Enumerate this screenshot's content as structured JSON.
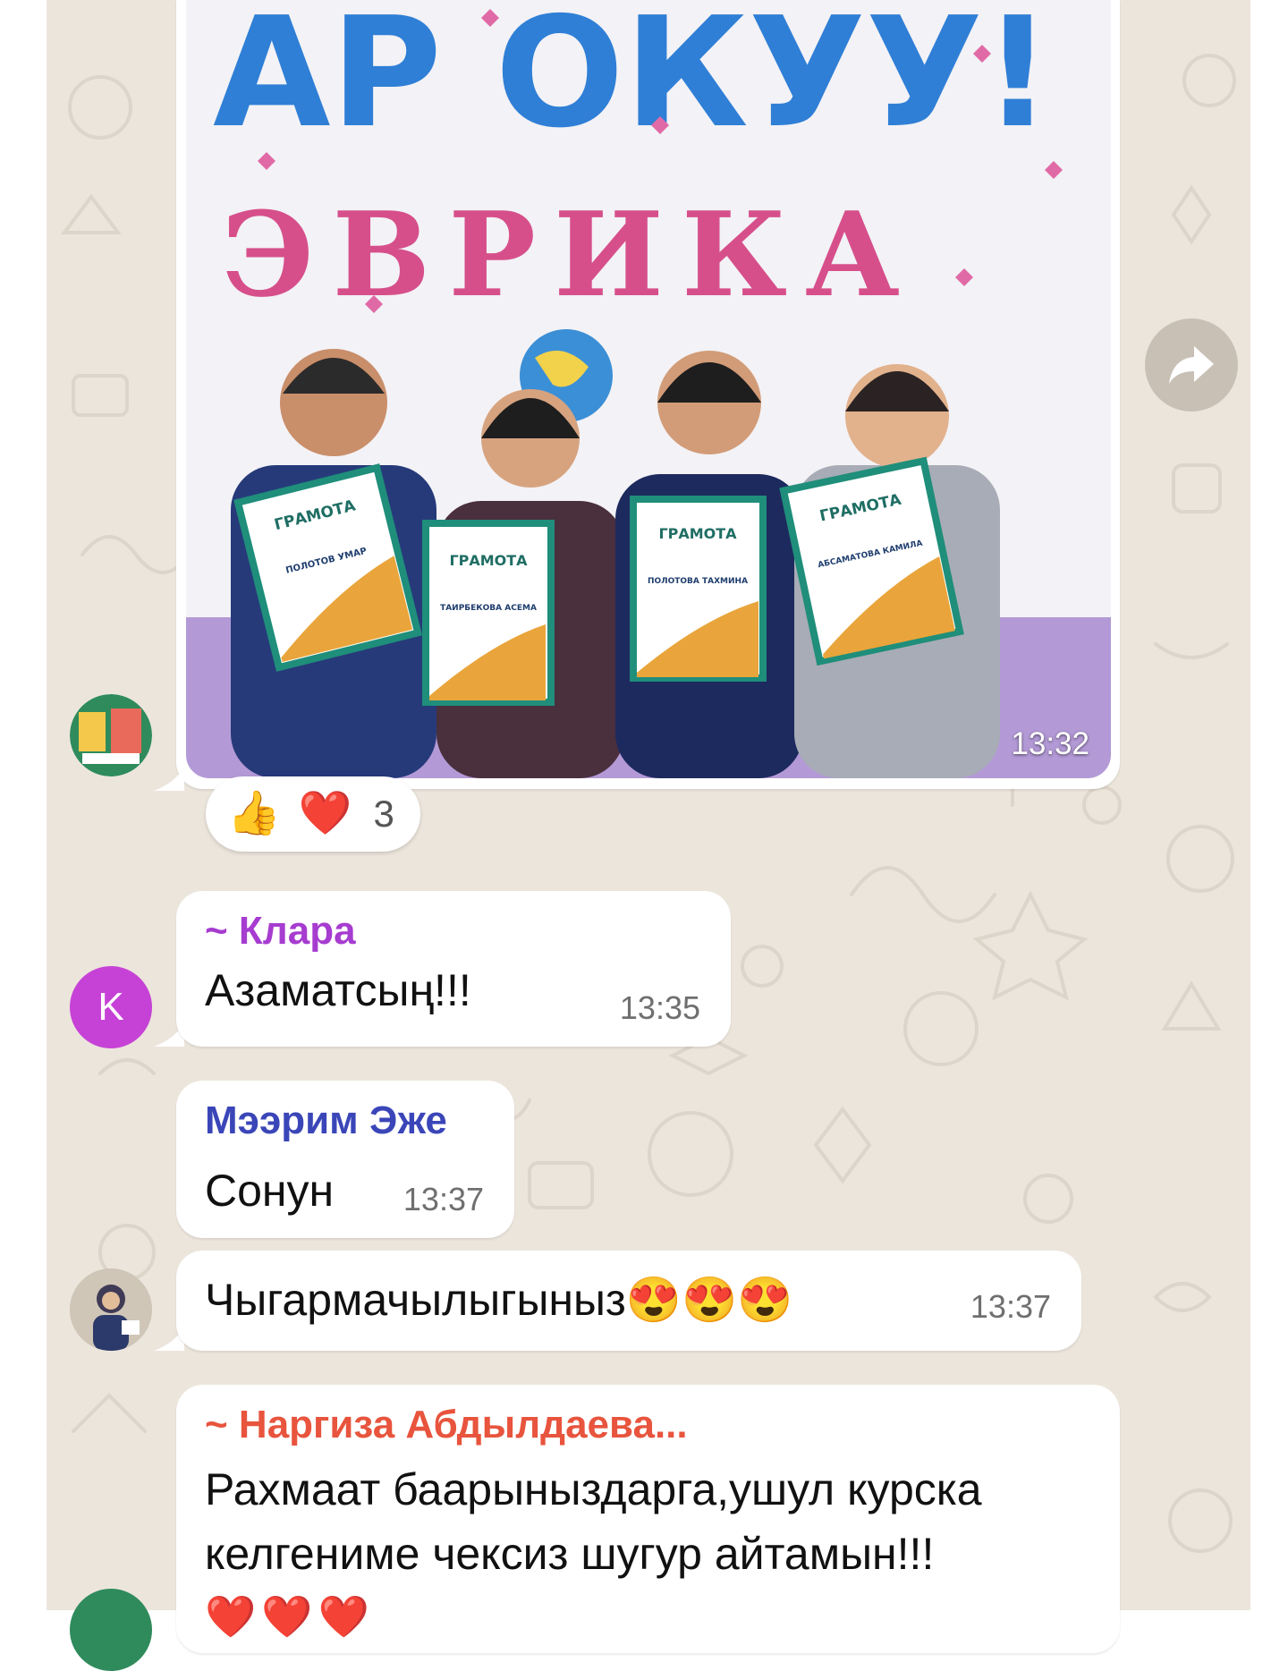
{
  "photo_message": {
    "time": "13:32",
    "banner_line1": "АР ОКУУ!",
    "banner_line2": "ЭВРИКА",
    "certificates": [
      {
        "title": "ГРАМОТА",
        "name": "ПОЛОТОВ УМАР"
      },
      {
        "title": "ГРАМОТА",
        "name": "ТАИРБЕКОВА АСЕМА"
      },
      {
        "title": "ГРАМОТА",
        "name": "ПОЛОТОВА ТАХМИНА"
      },
      {
        "title": "ГРАМОТА",
        "name": "АБСАМАТОВА КАМИЛА"
      }
    ]
  },
  "reactions": {
    "emojis": [
      "👍",
      "❤️"
    ],
    "count": "3"
  },
  "messages": [
    {
      "sender": "~ Клара",
      "avatar_letter": "K",
      "text": "Азаматсың!!!",
      "time": "13:35"
    },
    {
      "sender": "Мээрим Эже",
      "text": "Сонун",
      "time": "13:37"
    },
    {
      "text": "Чыгармачылыгыныз😍😍😍",
      "time": "13:37"
    },
    {
      "sender": "~ Наргиза Абдылдаева...",
      "text_line1": "Рахмаат баарыныздарга,ушул курска",
      "text_line2": "келгениме чексиз шугур айтамын!!!",
      "hearts": "❤️❤️❤️"
    }
  ],
  "colors": {
    "chat_background": "#ece5dc",
    "bubble": "#ffffff",
    "sender_klara": "#a63cd0",
    "sender_meerim": "#3a46b8",
    "sender_nargiza": "#e8543d",
    "avatar_k": "#c642d6"
  },
  "icons": {
    "forward": "forward-arrow-icon"
  }
}
